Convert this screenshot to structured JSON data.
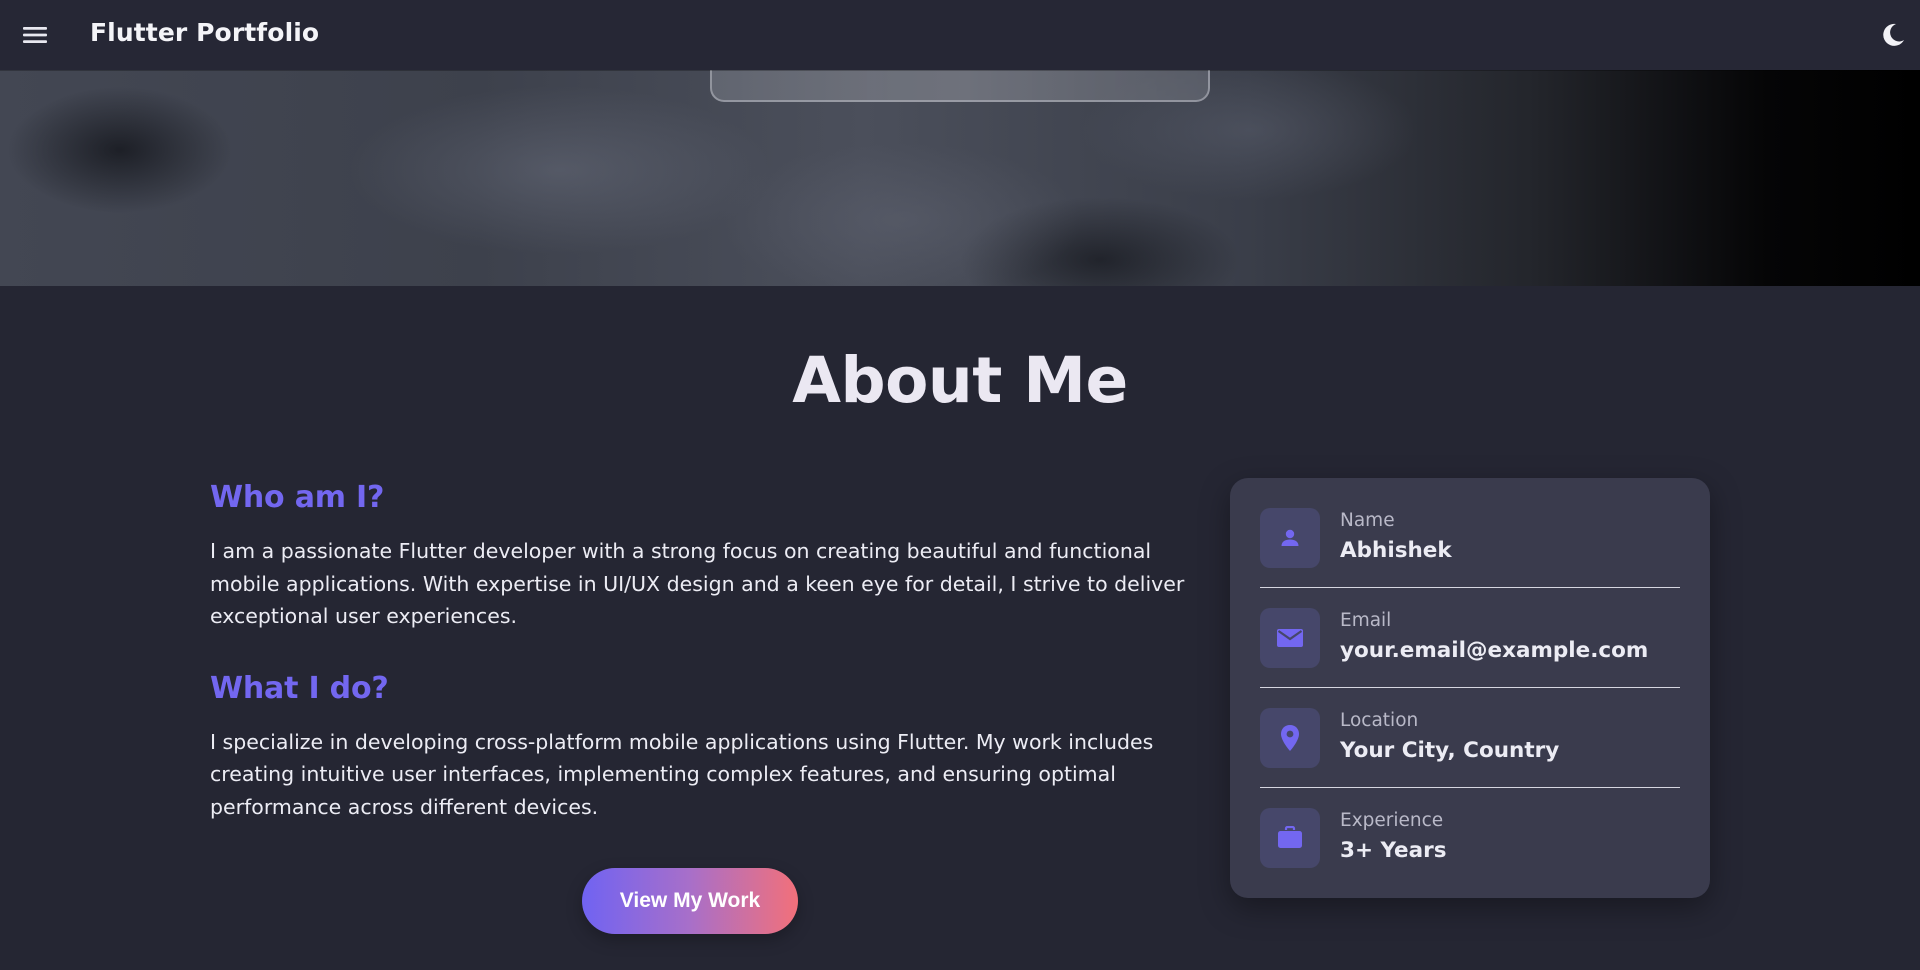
{
  "app": {
    "title": "Flutter Portfolio",
    "menu_icon": "hamburger-menu-icon",
    "theme_icon": "moon-icon"
  },
  "about": {
    "heading": "About Me",
    "who_title": "Who am I?",
    "who_text": "I am a passionate Flutter developer with a strong focus on creating beautiful and functional mobile applications. With expertise in UI/UX design and a keen eye for detail, I strive to deliver exceptional user experiences.",
    "what_title": "What I do?",
    "what_text": "I specialize in developing cross-platform mobile applications using Flutter. My work includes creating intuitive user interfaces, implementing complex features, and ensuring optimal performance across different devices.",
    "cta_label": "View My Work"
  },
  "info": {
    "items": [
      {
        "icon": "person-icon",
        "label": "Name",
        "value": "Abhishek"
      },
      {
        "icon": "email-icon",
        "label": "Email",
        "value": "your.email@example.com"
      },
      {
        "icon": "location-pin-icon",
        "label": "Location",
        "value": "Your City, Country"
      },
      {
        "icon": "briefcase-icon",
        "label": "Experience",
        "value": "3+ Years"
      }
    ]
  },
  "colors": {
    "accent": "#7367f0",
    "background": "#252633",
    "card": "#3a3b4d",
    "gradient_start": "#7063f2",
    "gradient_end": "#f2707a"
  }
}
